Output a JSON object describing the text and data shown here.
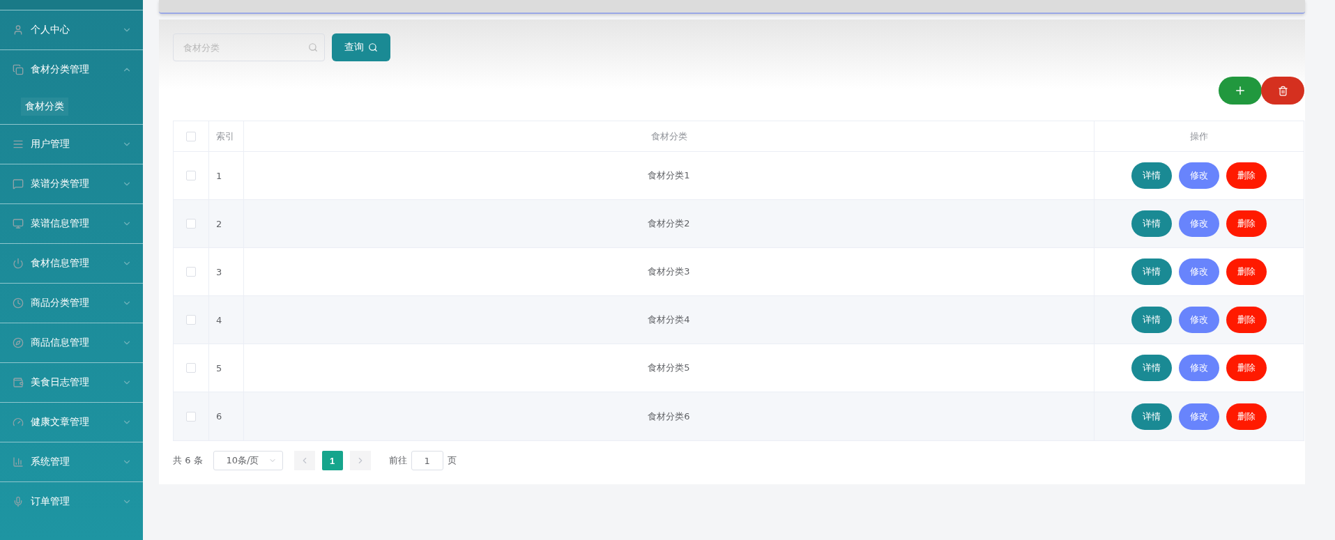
{
  "sidebar": {
    "items": [
      {
        "label": "个人中心",
        "expanded": false
      },
      {
        "label": "食材分类管理",
        "expanded": true,
        "children": [
          {
            "label": "食材分类",
            "selected": true
          }
        ]
      },
      {
        "label": "用户管理",
        "expanded": false
      },
      {
        "label": "菜谱分类管理",
        "expanded": false
      },
      {
        "label": "菜谱信息管理",
        "expanded": false
      },
      {
        "label": "食材信息管理",
        "expanded": false
      },
      {
        "label": "商品分类管理",
        "expanded": false
      },
      {
        "label": "商品信息管理",
        "expanded": false
      },
      {
        "label": "美食日志管理",
        "expanded": false
      },
      {
        "label": "健康文章管理",
        "expanded": false
      },
      {
        "label": "系统管理",
        "expanded": false
      },
      {
        "label": "订单管理",
        "expanded": false
      }
    ]
  },
  "search": {
    "placeholder": "食材分类",
    "button": "查询"
  },
  "table": {
    "select_all_checked": false,
    "columns": [
      "索引",
      "食材分类",
      "操作"
    ],
    "rows": [
      {
        "index": "1",
        "name": "食材分类1",
        "checked": false,
        "actions": [
          "详情",
          "修改",
          "删除"
        ]
      },
      {
        "index": "2",
        "name": "食材分类2",
        "checked": false,
        "actions": [
          "详情",
          "修改",
          "删除"
        ]
      },
      {
        "index": "3",
        "name": "食材分类3",
        "checked": false,
        "actions": [
          "详情",
          "修改",
          "删除"
        ]
      },
      {
        "index": "4",
        "name": "食材分类4",
        "checked": false,
        "actions": [
          "详情",
          "修改",
          "删除"
        ]
      },
      {
        "index": "5",
        "name": "食材分类5",
        "checked": false,
        "actions": [
          "详情",
          "修改",
          "删除"
        ]
      },
      {
        "index": "6",
        "name": "食材分类6",
        "checked": false,
        "actions": [
          "详情",
          "修改",
          "删除"
        ]
      }
    ]
  },
  "pagination": {
    "total": "共 6 条",
    "page_size": "10条/页",
    "pages": [
      {
        "label": "1",
        "selected": true
      }
    ],
    "goto_label": "前往",
    "goto_value": "1",
    "goto_suffix": "页"
  }
}
